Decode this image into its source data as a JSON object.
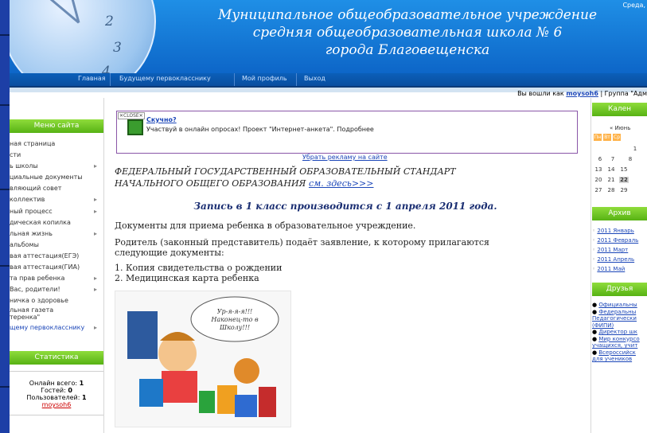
{
  "header": {
    "date": "Среда,",
    "title_line1": "Муниципальное общеобразовательное учреждение",
    "title_line2": "средняя общеобразовательная школа № 6",
    "title_line3": "города Благовещенска",
    "clock_numbers": [
      "2",
      "3",
      "4"
    ]
  },
  "nav": {
    "items": [
      "Главная",
      "Будущему первокласснику",
      "Мой профиль",
      "Выход"
    ]
  },
  "login": {
    "prefix": "Вы вошли как",
    "user": "moysoh6",
    "group": "| Группа \"Адм"
  },
  "sidebar": {
    "menu_title": "Меню сайта",
    "items": [
      {
        "label": "ная страница",
        "arrow": ""
      },
      {
        "label": "сти",
        "arrow": ""
      },
      {
        "label": "ь школы",
        "arrow": "▸"
      },
      {
        "label": "циальные документы",
        "arrow": ""
      },
      {
        "label": "вляющий совет",
        "arrow": ""
      },
      {
        "label": "коллектив",
        "arrow": "▸"
      },
      {
        "label": "ный процесс",
        "arrow": "▸"
      },
      {
        "label": "дическая копилка",
        "arrow": ""
      },
      {
        "label": "льная жизнь",
        "arrow": "▸"
      },
      {
        "label": "альбомы",
        "arrow": ""
      },
      {
        "label": "вая аттестация(ЕГЭ)",
        "arrow": ""
      },
      {
        "label": "вая аттестация(ГИА)",
        "arrow": ""
      },
      {
        "label": "та прав ребенка",
        "arrow": "▸"
      },
      {
        "label": "Вас, родители!",
        "arrow": "▸"
      },
      {
        "label": "ничка о здоровье",
        "arrow": ""
      },
      {
        "label": "льная газета",
        "arrow": ""
      },
      {
        "label": "теренка\"",
        "arrow": ""
      },
      {
        "label": "щему первокласснику",
        "arrow": "▸"
      }
    ],
    "stats_title": "Статистика",
    "stats": {
      "online_label": "Онлайн всего:",
      "online": "1",
      "guests_label": "Гостей:",
      "guests": "0",
      "users_label": "Пользователей:",
      "users": "1",
      "user_name": "moysoh6"
    }
  },
  "ad": {
    "close": "CLOSE",
    "link": "Скучно?",
    "text": "Участвуй в онлайн опросах! Проект \"Интернет-анкета\". Подробнее",
    "remove": "Убрать рекламу на сайте"
  },
  "main": {
    "fgos_line1": "ФЕДЕРАЛЬНЫЙ ГОСУДАРСТВЕННЫЙ ОБРАЗОВАТЕЛЬНЫЙ СТАНДАРТ",
    "fgos_line2": "НАЧАЛЬНОГО ОБЩЕГО ОБРАЗОВАНИЯ",
    "fgos_link": "см. здесь>>>",
    "heading": "Запись в 1 класс производится с 1 апреля 2011 года.",
    "p1": "Документы для приема ребенка в образовательное учреждение.",
    "p2": "Родитель (законный представитель) подаёт заявление, к которому прилагаются следующие документы:",
    "list": [
      "1. Копия свидетельства о рождении",
      "2. Медицинская карта ребенка"
    ],
    "pic_text": "Ур-я-я-я!!! Наконец-то в Школу!!!"
  },
  "right": {
    "calendar_title": "Кален",
    "month": "« Июнь",
    "weekdays": [
      "Пн",
      "Вт",
      "Ср"
    ],
    "days": [
      [
        "",
        "",
        "1"
      ],
      [
        "6",
        "7",
        "8"
      ],
      [
        "13",
        "14",
        "15"
      ],
      [
        "20",
        "21",
        "22"
      ],
      [
        "27",
        "28",
        "29"
      ]
    ],
    "archive_title": "Архив",
    "archive": [
      "2011 Январь",
      "2011 Февраль",
      "2011 Март",
      "2011 Апрель",
      "2011 Май"
    ],
    "friends_title": "Друзья",
    "friends": [
      "Официальны",
      "Федеральны",
      "Педагогически",
      "(ФИПИ)",
      "Директор шк",
      "Мир конкурсо",
      "учащихся, учит",
      "Всероссийск",
      "для учеников"
    ]
  }
}
